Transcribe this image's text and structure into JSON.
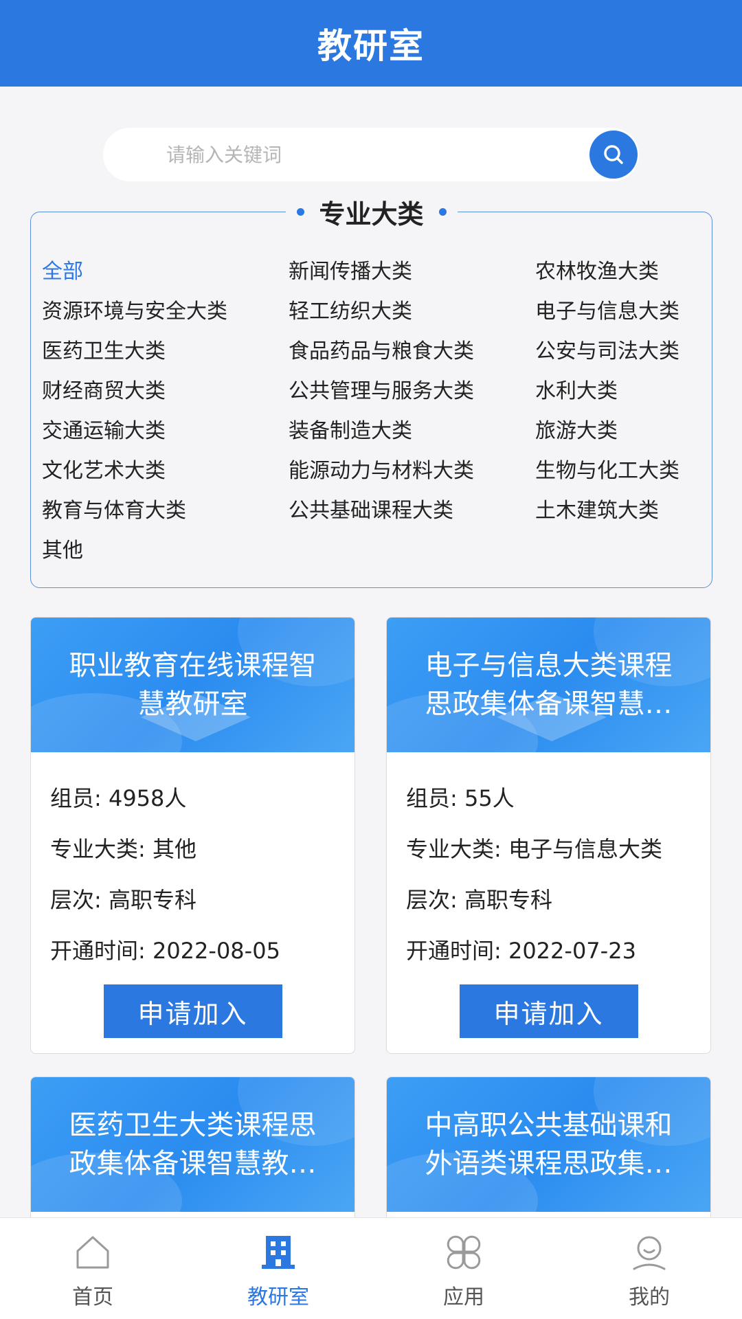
{
  "header": {
    "title": "教研室"
  },
  "search": {
    "placeholder": "请输入关键词"
  },
  "categories": {
    "title": "专业大类",
    "items": [
      {
        "label": "全部",
        "active": true
      },
      {
        "label": "新闻传播大类"
      },
      {
        "label": "农林牧渔大类"
      },
      {
        "label": "资源环境与安全大类"
      },
      {
        "label": "轻工纺织大类"
      },
      {
        "label": "电子与信息大类"
      },
      {
        "label": "医药卫生大类"
      },
      {
        "label": "食品药品与粮食大类"
      },
      {
        "label": "公安与司法大类"
      },
      {
        "label": "财经商贸大类"
      },
      {
        "label": "公共管理与服务大类"
      },
      {
        "label": "水利大类"
      },
      {
        "label": "交通运输大类"
      },
      {
        "label": "装备制造大类"
      },
      {
        "label": "旅游大类"
      },
      {
        "label": "文化艺术大类"
      },
      {
        "label": "能源动力与材料大类"
      },
      {
        "label": "生物与化工大类"
      },
      {
        "label": "教育与体育大类"
      },
      {
        "label": "公共基础课程大类"
      },
      {
        "label": "土木建筑大类"
      },
      {
        "label": "其他"
      }
    ]
  },
  "cards": [
    {
      "title": "职业教育在线课程智慧教研室",
      "members": "组员: 4958人",
      "category": "专业大类: 其他",
      "level": "层次: 高职专科",
      "opened": "开通时间: 2022-08-05",
      "button": "申请加入"
    },
    {
      "title": "电子与信息大类课程思政集体备课智慧教研室",
      "members": "组员: 55人",
      "category": "专业大类: 电子与信息大类",
      "level": "层次: 高职专科",
      "opened": "开通时间: 2022-07-23",
      "button": "申请加入"
    },
    {
      "title": "医药卫生大类课程思政集体备课智慧教研室"
    },
    {
      "title": "中高职公共基础课和外语类课程思政集体备课智慧教研室"
    }
  ],
  "nav": {
    "items": [
      {
        "label": "首页",
        "icon": "home-icon"
      },
      {
        "label": "教研室",
        "icon": "building-icon",
        "active": true
      },
      {
        "label": "应用",
        "icon": "apps-icon"
      },
      {
        "label": "我的",
        "icon": "user-icon"
      }
    ]
  },
  "colors": {
    "primary": "#2a78e0",
    "background": "#f5f5f7"
  }
}
